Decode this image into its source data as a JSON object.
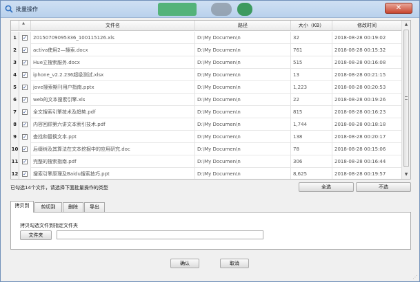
{
  "window": {
    "title": "批量操作",
    "close_glyph": "✕"
  },
  "grid": {
    "headers": {
      "name": "文件名",
      "path": "路径",
      "size": "大小（KB）",
      "time": "修改时间"
    },
    "rows": [
      {
        "num": "1",
        "name": "20150709095336_100115126.xls",
        "path": "D:\\My Documen\\n",
        "size": "32",
        "time": "2018-08-28 00:19:02"
      },
      {
        "num": "2",
        "name": "activa使用2—搜索.docx",
        "path": "D:\\My Documen\\n",
        "size": "761",
        "time": "2018-08-28 00:15:32"
      },
      {
        "num": "3",
        "name": "Hue立搜索服务.docx",
        "path": "D:\\My Documen\\n",
        "size": "515",
        "time": "2018-08-28 00:16:08"
      },
      {
        "num": "4",
        "name": "iphone_v2.2.236超级测试.xlsx",
        "path": "D:\\My Documen\\n",
        "size": "13",
        "time": "2018-08-28 00:21:15"
      },
      {
        "num": "5",
        "name": "jove搜索期刊用户指南.pptx",
        "path": "D:\\My Documen\\n",
        "size": "1,223",
        "time": "2018-08-28 00:20:53"
      },
      {
        "num": "6",
        "name": "web的文本搜索引擎.xls",
        "path": "D:\\My Documen\\n",
        "size": "22",
        "time": "2018-08-28 00:19:26"
      },
      {
        "num": "7",
        "name": "全文搜索引擎技术及趋势.pdf",
        "path": "D:\\My Documen\\n",
        "size": "815",
        "time": "2018-08-28 00:16:23"
      },
      {
        "num": "8",
        "name": "内容回顾第六讲文本索引技术.pdf",
        "path": "D:\\My Documen\\n",
        "size": "1,744",
        "time": "2018-08-28 00:18:18"
      },
      {
        "num": "9",
        "name": "查找和替换文本.ppt",
        "path": "D:\\My Documen\\n",
        "size": "138",
        "time": "2018-08-28 00:20:17"
      },
      {
        "num": "10",
        "name": "后缀树及其算法在文本挖掘中的应用研究.doc",
        "path": "D:\\My Documen\\n",
        "size": "78",
        "time": "2018-08-28 00:15:06"
      },
      {
        "num": "11",
        "name": "完整的搜索指南.pdf",
        "path": "D:\\My Documen\\n",
        "size": "306",
        "time": "2018-08-28 00:16:44"
      },
      {
        "num": "12",
        "name": "搜索引擎原理及Baidu搜索技巧.ppt",
        "path": "D:\\My Documen\\n",
        "size": "8,625",
        "time": "2018-08-28 00:19:57"
      }
    ],
    "checkmark": "✓"
  },
  "status": {
    "text": "已勾选14个文件，请选择下面批量操作的类型"
  },
  "buttons": {
    "select_all": "全选",
    "unselect": "不选",
    "ok": "确认",
    "cancel": "取消",
    "folder": "文件夹"
  },
  "tabs": [
    "拷贝到",
    "剪切到",
    "删除",
    "导出"
  ],
  "panel": {
    "label": "拷贝勾选文件到指定文件夹",
    "path_value": ""
  }
}
